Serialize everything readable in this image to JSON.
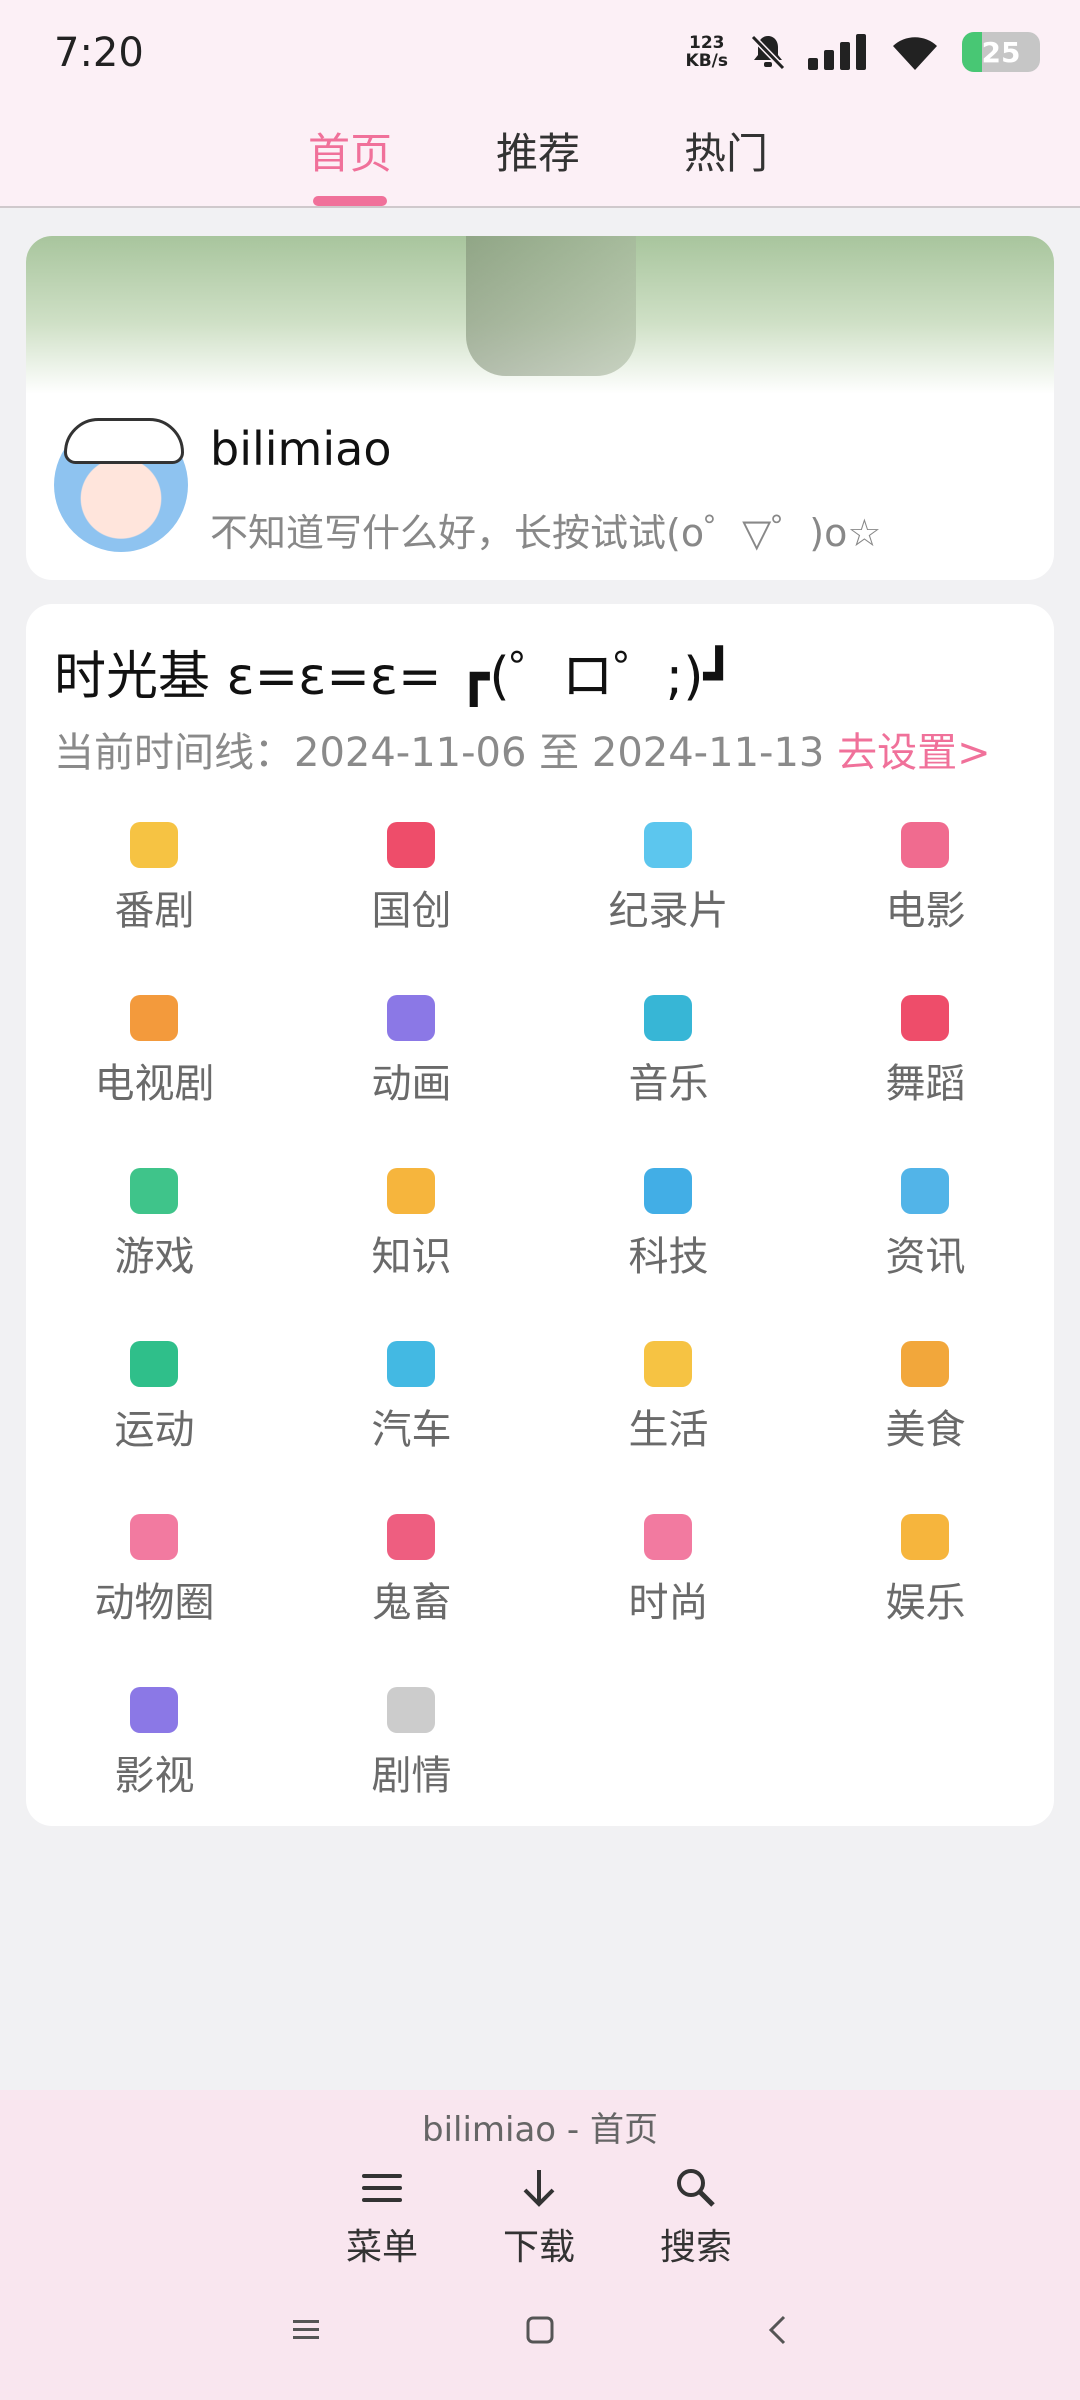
{
  "status": {
    "time": "7:20",
    "net_speed_value": "123",
    "net_speed_unit": "KB/s",
    "battery": "25",
    "battery_fraction": 0.25
  },
  "tabs": [
    {
      "label": "首页",
      "active": true
    },
    {
      "label": "推荐",
      "active": false
    },
    {
      "label": "热门",
      "active": false
    }
  ],
  "profile": {
    "username": "bilimiao",
    "signature": "不知道写什么好，长按试试(o゜▽゜)o☆"
  },
  "timeline": {
    "title": "时光基  ε=ε=ε= ┏(゜ロ゜;)┛",
    "range_prefix": "当前时间线：2024-11-06 至 2024-11-13 ",
    "settings_link": "去设置>",
    "categories": [
      {
        "label": "番剧",
        "icon": "tv-icon",
        "color": "#f6c343"
      },
      {
        "label": "国创",
        "icon": "peach-icon",
        "color": "#ee4d6a"
      },
      {
        "label": "纪录片",
        "icon": "whale-icon",
        "color": "#5cc6ee"
      },
      {
        "label": "电影",
        "icon": "3d-glasses-icon",
        "color": "#f06b8f"
      },
      {
        "label": "电视剧",
        "icon": "sofa-icon",
        "color": "#f39a3c"
      },
      {
        "label": "动画",
        "icon": "play-icon",
        "color": "#8b78e6"
      },
      {
        "label": "音乐",
        "icon": "headphones-icon",
        "color": "#37b6d6"
      },
      {
        "label": "舞蹈",
        "icon": "fan-icon",
        "color": "#ee4d6a"
      },
      {
        "label": "游戏",
        "icon": "creeper-icon",
        "color": "#3fc48a"
      },
      {
        "label": "知识",
        "icon": "lightbulb-icon",
        "color": "#f6b53d"
      },
      {
        "label": "科技",
        "icon": "ufo-icon",
        "color": "#42aee6"
      },
      {
        "label": "资讯",
        "icon": "news-icon",
        "color": "#52b4e8"
      },
      {
        "label": "运动",
        "icon": "runner-icon",
        "color": "#2fbf8a"
      },
      {
        "label": "汽车",
        "icon": "car-icon",
        "color": "#43b9e3"
      },
      {
        "label": "生活",
        "icon": "duck-icon",
        "color": "#f6c343"
      },
      {
        "label": "美食",
        "icon": "food-bowl-icon",
        "color": "#f2a73b"
      },
      {
        "label": "动物圈",
        "icon": "paw-icon",
        "color": "#f27aa0"
      },
      {
        "label": "鬼畜",
        "icon": "flower-face-icon",
        "color": "#ee5e80"
      },
      {
        "label": "时尚",
        "icon": "dress-icon",
        "color": "#f27aa0"
      },
      {
        "label": "娱乐",
        "icon": "magic-wand-icon",
        "color": "#f6b53d"
      },
      {
        "label": "影视",
        "icon": "clapper-icon",
        "color": "#8b78e6"
      },
      {
        "label": "剧情",
        "icon": "bilibili-tv-icon",
        "color": "#cccccc"
      }
    ]
  },
  "bottom": {
    "title": "bilimiao - 首页",
    "menu_label": "菜单",
    "download_label": "下载",
    "search_label": "搜索"
  },
  "colors": {
    "accent": "#f0719a",
    "header_bg": "#fcf0f6",
    "bottom_bg": "#f9e6ef"
  }
}
